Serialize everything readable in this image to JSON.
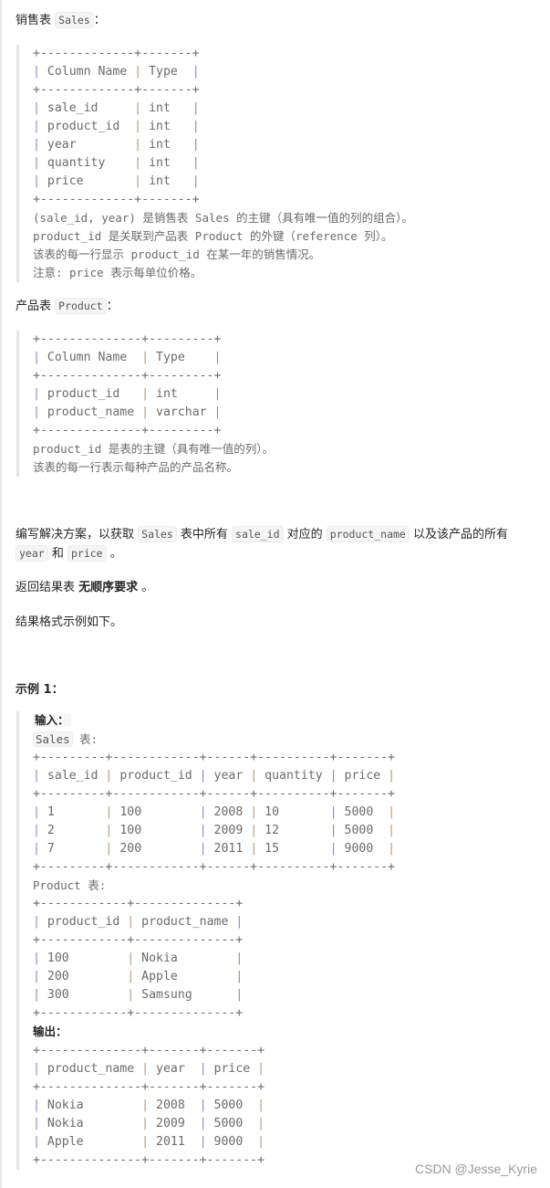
{
  "sales_heading": {
    "prefix": "销售表 ",
    "code": "Sales",
    "suffix": "："
  },
  "sales_schema": {
    "header": [
      "Column Name",
      "Type"
    ],
    "rows": [
      [
        "sale_id",
        "int"
      ],
      [
        "product_id",
        "int"
      ],
      [
        "year",
        "int"
      ],
      [
        "quantity",
        "int"
      ],
      [
        "price",
        "int"
      ]
    ],
    "widths": [
      13,
      7
    ],
    "notes": [
      "(sale_id, year) 是销售表 Sales 的主键（具有唯一值的列的组合）。",
      "product_id 是关联到产品表 Product 的外键（reference 列）。",
      "该表的每一行显示 product_id 在某一年的销售情况。",
      "注意: price 表示每单位价格。"
    ]
  },
  "product_heading": {
    "prefix": "产品表 ",
    "code": "Product",
    "suffix": "："
  },
  "product_schema": {
    "header": [
      "Column Name",
      "Type"
    ],
    "rows": [
      [
        "product_id",
        "int"
      ],
      [
        "product_name",
        "varchar"
      ]
    ],
    "widths": [
      14,
      9
    ],
    "notes": [
      "product_id 是表的主键（具有唯一值的列）。",
      "该表的每一行表示每种产品的产品名称。"
    ]
  },
  "task": {
    "t1": "编写解决方案，以获取 ",
    "c1": "Sales",
    "t2": " 表中所有 ",
    "c2": "sale_id",
    "t3": " 对应的 ",
    "c3": "product_name",
    "t4": " 以及该产品的所有 ",
    "c4": "year",
    "t5": " 和 ",
    "c5": "price",
    "t6": " 。"
  },
  "return_line": {
    "text": "返回结果表 ",
    "bold": "无顺序要求",
    "suffix": " 。"
  },
  "format_line": "结果格式示例如下。",
  "example_title": "示例 1：",
  "example": {
    "input_label": "输入：",
    "sales_label_code": "Sales",
    "sales_label_suffix": " 表:",
    "sales_table": {
      "header": [
        "sale_id",
        "product_id",
        "year",
        "quantity",
        "price"
      ],
      "widths": [
        9,
        12,
        6,
        10,
        7
      ],
      "rows": [
        [
          "1",
          "100",
          "2008",
          "10",
          "5000"
        ],
        [
          "2",
          "100",
          "2009",
          "12",
          "5000"
        ],
        [
          "7",
          "200",
          "2011",
          "15",
          "9000"
        ]
      ]
    },
    "product_label": "Product 表:",
    "product_table": {
      "header": [
        "product_id",
        "product_name"
      ],
      "widths": [
        12,
        14
      ],
      "rows": [
        [
          "100",
          "Nokia"
        ],
        [
          "200",
          "Apple"
        ],
        [
          "300",
          "Samsung"
        ]
      ]
    },
    "output_label": "输出：",
    "output_table": {
      "header": [
        "product_name",
        "year",
        "price"
      ],
      "widths": [
        14,
        7,
        7
      ],
      "rows": [
        [
          "Nokia",
          "2008",
          "5000"
        ],
        [
          "Nokia",
          "2009",
          "5000"
        ],
        [
          "Apple",
          "2011",
          "9000"
        ]
      ]
    }
  },
  "watermark": "CSDN @Jesse_Kyrie"
}
